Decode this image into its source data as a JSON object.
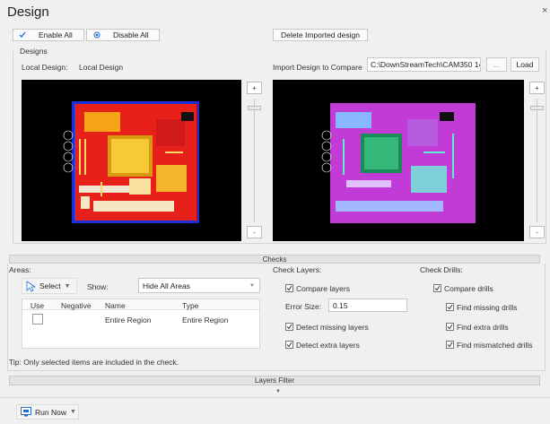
{
  "window": {
    "title": "Design",
    "close_glyph": "×"
  },
  "toolbar": {
    "enable_all": "Enable All",
    "disable_all": "Disable All",
    "delete_imported": "Delete Imported design"
  },
  "designs": {
    "group_label": "Designs",
    "local_design_label": "Local Design:",
    "local_design_value": "Local Design",
    "import_label": "Import Design to Compare",
    "import_path": "C:\\DownStreamTech\\CAM350 14",
    "browse_label": "...",
    "load_label": "Load",
    "zoom_in": "+",
    "zoom_out": "-"
  },
  "checks": {
    "header": "Checks",
    "areas": {
      "label": "Areas:",
      "select_label": "Select",
      "show_label": "Show:",
      "show_value": "Hide All Areas",
      "columns": [
        "Use",
        "Negative",
        "Name",
        "Type"
      ],
      "rows": [
        {
          "use": false,
          "negative": "",
          "name": "Entire Region",
          "type": "Entire Region"
        }
      ],
      "tip": "Tip: Only selected items are included in the check."
    },
    "check_layers": {
      "label": "Check Layers:",
      "compare_layers": "Compare layers",
      "error_size_label": "Error Size:",
      "error_size_value": "0.15",
      "detect_missing": "Detect missing layers",
      "detect_extra": "Detect extra layers"
    },
    "check_drills": {
      "label": "Check Drills:",
      "compare_drills": "Compare drills",
      "find_missing": "Find missing drills",
      "find_extra": "Find extra drills",
      "find_mismatched": "Find mismatched drills"
    }
  },
  "layers_filter": {
    "header": "Layers Filter"
  },
  "footer": {
    "run_now": "Run Now"
  },
  "colors": {
    "accent": "#1e6fd0",
    "board_red": "#e8201a",
    "board_magenta": "#c33bd6"
  }
}
